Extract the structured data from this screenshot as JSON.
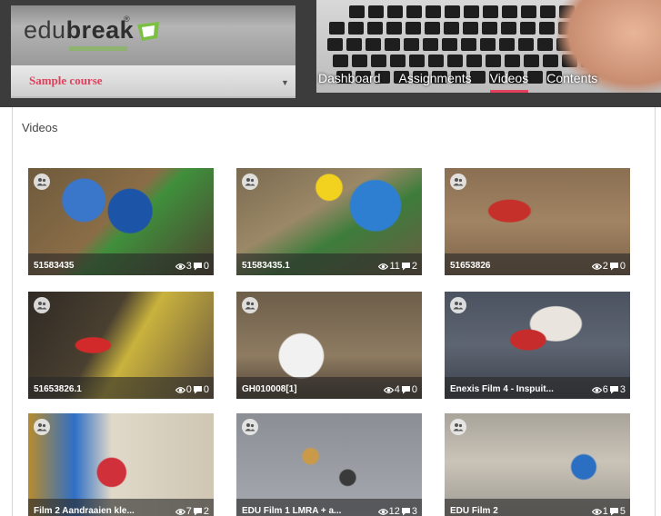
{
  "header": {
    "logo_text_light": "edu",
    "logo_text_bold": "break",
    "logo_registered": "®",
    "course_selector": "Sample course"
  },
  "nav": {
    "items": [
      {
        "label": "Dashboard",
        "active": false
      },
      {
        "label": "Assignments",
        "active": false
      },
      {
        "label": "Videos",
        "active": true
      },
      {
        "label": "Contents",
        "active": false
      }
    ]
  },
  "page": {
    "title": "Videos"
  },
  "videos": [
    {
      "title": "51583435",
      "views": "3",
      "comments": "0"
    },
    {
      "title": "51583435.1",
      "views": "11",
      "comments": "2"
    },
    {
      "title": "51653826",
      "views": "2",
      "comments": "0"
    },
    {
      "title": "51653826.1",
      "views": "0",
      "comments": "0"
    },
    {
      "title": "GH010008[1]",
      "views": "4",
      "comments": "0"
    },
    {
      "title": "Enexis Film 4 - Inspuit...",
      "views": "6",
      "comments": "3"
    },
    {
      "title": "Film 2 Aandraaien kle...",
      "views": "7",
      "comments": "2"
    },
    {
      "title": "EDU Film 1 LMRA + a...",
      "views": "12",
      "comments": "3"
    },
    {
      "title": "EDU Film 2",
      "views": "1",
      "comments": "5"
    }
  ],
  "colors": {
    "accent": "#e2405c",
    "header_bg": "#3c3c3c",
    "logo_green": "#7cc043"
  }
}
